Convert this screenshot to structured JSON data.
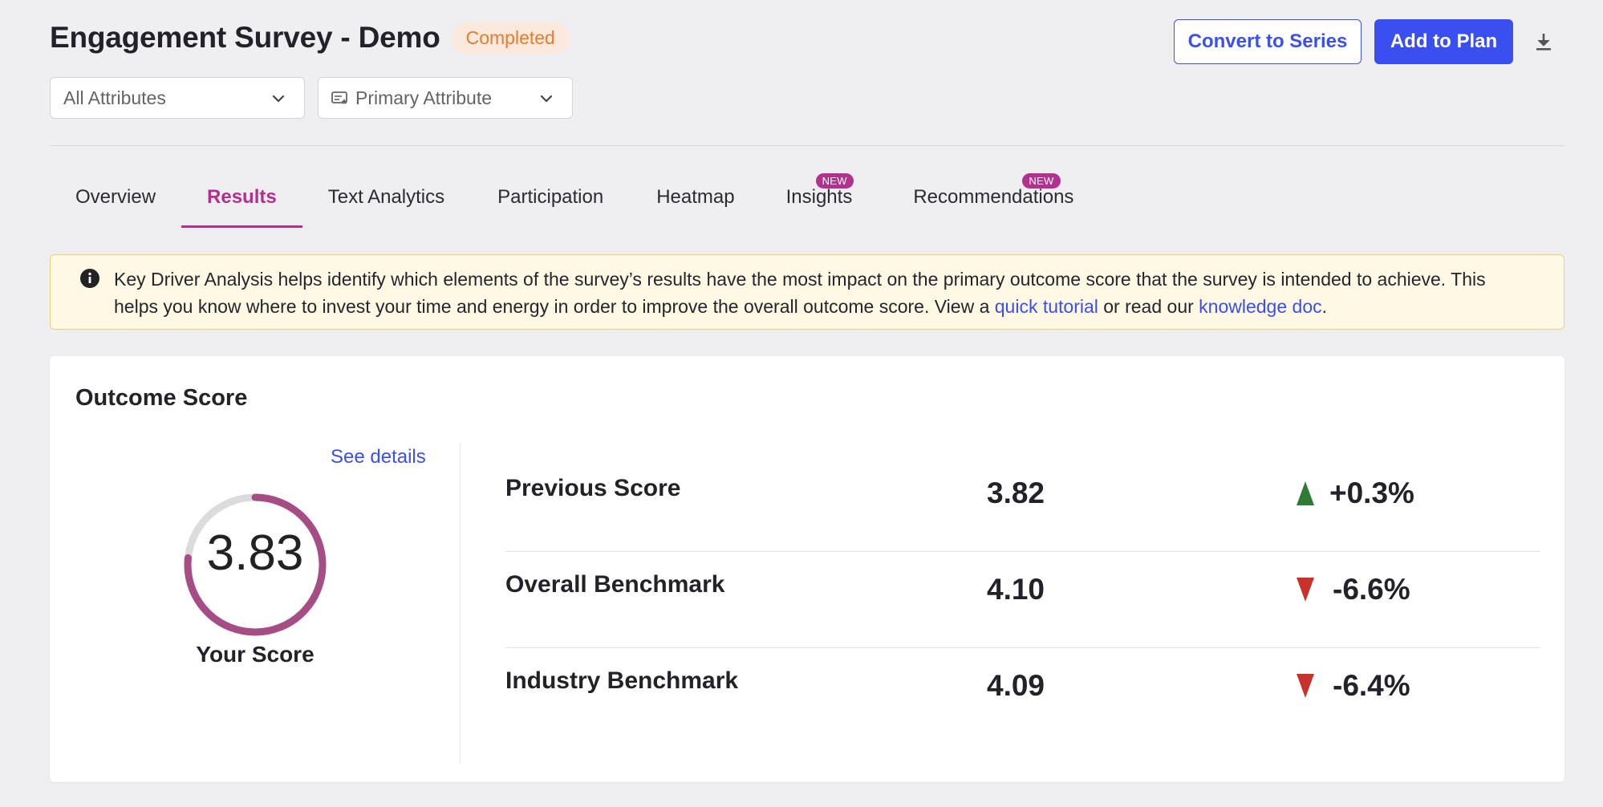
{
  "header": {
    "title": "Engagement Survey - Demo",
    "status": "Completed"
  },
  "filters": {
    "attributes": "All Attributes",
    "primary": "Primary Attribute"
  },
  "actions": {
    "convert": "Convert to Series",
    "add": "Add to Plan"
  },
  "tabs": [
    {
      "label": "Overview"
    },
    {
      "label": "Results",
      "active": true
    },
    {
      "label": "Text Analytics"
    },
    {
      "label": "Participation"
    },
    {
      "label": "Heatmap"
    },
    {
      "label": "Insights",
      "badge": "NEW"
    },
    {
      "label": "Recommendations",
      "badge": "NEW"
    }
  ],
  "info": {
    "text": "Key Driver Analysis helps identify which elements of the survey’s results have the most impact on the primary outcome score that the survey is intended to achieve. This helps you know where to invest your time and energy in order to improve the overall outcome score.  View a ",
    "link1": "quick tutorial",
    "mid": " or read our ",
    "link2": "knowledge doc",
    "end": "."
  },
  "card": {
    "title": "Outcome Score",
    "see_details": "See details",
    "score": "3.83",
    "score_fraction": 0.766,
    "score_label": "Your Score",
    "rows": [
      {
        "label": "Previous Score",
        "value": "3.82",
        "change": "+0.3%",
        "direction": "up"
      },
      {
        "label": "Overall Benchmark",
        "value": "4.10",
        "change": "-6.6%",
        "direction": "down"
      },
      {
        "label": "Industry Benchmark",
        "value": "4.09",
        "change": "-6.4%",
        "direction": "down"
      }
    ]
  },
  "colors": {
    "accent": "#b3318e",
    "primary": "#3a4ff0",
    "gauge": "#a74d86",
    "up": "#2f7a35",
    "down": "#c8322b"
  }
}
